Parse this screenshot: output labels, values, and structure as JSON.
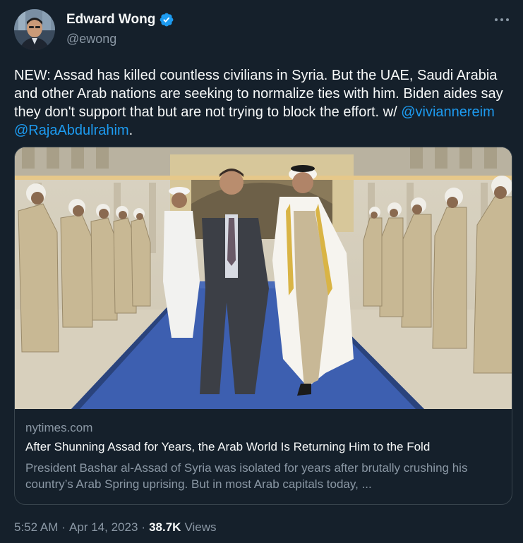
{
  "author": {
    "display_name": "Edward Wong",
    "handle": "@ewong",
    "verified_color": "#1d9bf0"
  },
  "more_icon": "more-horizontal-icon",
  "tweet": {
    "text_before": "NEW: Assad has killed countless civilians in Syria. But the UAE, Saudi Arabia and other Arab nations are seeking to normalize ties with him. Biden aides say they don't support that but are not trying to block the effort. w/ ",
    "mention_1": "@viviannereim",
    "mention_2": "@RajaAbdulrahim",
    "text_after": "."
  },
  "card": {
    "domain": "nytimes.com",
    "title": "After Shunning Assad for Years, the Arab World Is Returning Him to the Fold",
    "description": "President Bashar al-Assad of Syria was isolated for years after brutally crushing his country’s Arab Spring uprising. But in most Arab capitals today, ..."
  },
  "footer": {
    "time": "5:52 AM",
    "separator": "·",
    "date": "Apr 14, 2023",
    "views_count": "38.7K",
    "views_label": "Views"
  },
  "colors": {
    "background": "#15202b",
    "text": "#f7f9f9",
    "secondary": "#8b98a5",
    "link": "#1d9bf0",
    "border": "#38444d"
  }
}
